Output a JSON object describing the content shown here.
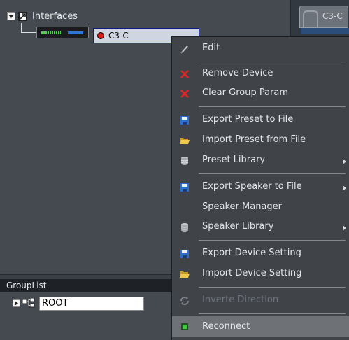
{
  "tree": {
    "root_label": "Interfaces",
    "device_name": "C3-C"
  },
  "right_tab": {
    "label": "C3-C"
  },
  "group_list": {
    "header": "GroupList",
    "root_label": "ROOT"
  },
  "context_menu": {
    "items": [
      {
        "label": "Edit",
        "icon": "edit-icon"
      },
      {
        "label": "Remove Device",
        "icon": "remove-x-icon"
      },
      {
        "label": "Clear Group Param",
        "icon": "clear-x-icon"
      },
      {
        "label": "Export Preset to File",
        "icon": "save-icon"
      },
      {
        "label": "Import Preset from File",
        "icon": "folder-open-icon"
      },
      {
        "label": "Preset Library",
        "icon": "database-icon",
        "submenu": true
      },
      {
        "label": "Export Speaker to File",
        "icon": "save-icon",
        "submenu": true
      },
      {
        "label": "Speaker Manager",
        "icon": ""
      },
      {
        "label": "Speaker Library",
        "icon": "database-icon",
        "submenu": true
      },
      {
        "label": "Export Device Setting",
        "icon": "save-icon"
      },
      {
        "label": "Import Device Setting",
        "icon": "folder-open-icon"
      },
      {
        "label": "Inverte Direction",
        "icon": "rotate-icon",
        "disabled": true
      },
      {
        "label": "Reconnect",
        "icon": "reconnect-icon",
        "selected": true
      }
    ]
  },
  "colors": {
    "selection_blue": "#0b1c84",
    "record_red": "#d81c1c",
    "reconnect_green": "#3ccc3c"
  }
}
